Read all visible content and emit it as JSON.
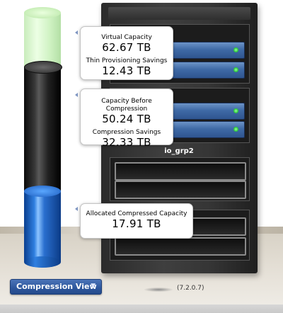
{
  "io_group_label": "io_grp2",
  "version": "(7.2.0.7)",
  "view_button": {
    "label": "Compression View",
    "chevron": "chevron-down-icon"
  },
  "callouts": {
    "virtual_capacity": {
      "label": "Virtual Capacity",
      "value": "62.67 TB"
    },
    "thin_provisioning": {
      "label": "Thin Provisioning Savings",
      "value": "12.43 TB"
    },
    "capacity_before_compression": {
      "label": "Capacity Before Compression",
      "value": "50.24 TB"
    },
    "compression_savings": {
      "label": "Compression Savings",
      "value": "32.33 TB"
    },
    "allocated_compressed": {
      "label": "Allocated Compressed Capacity",
      "value": "17.91 TB"
    }
  },
  "colors": {
    "virtual_capacity": "#c7f0b8",
    "capacity_before_compression": "#3a3a3a",
    "allocated_compressed": "#2f7fe0",
    "button": "#2d569c"
  }
}
